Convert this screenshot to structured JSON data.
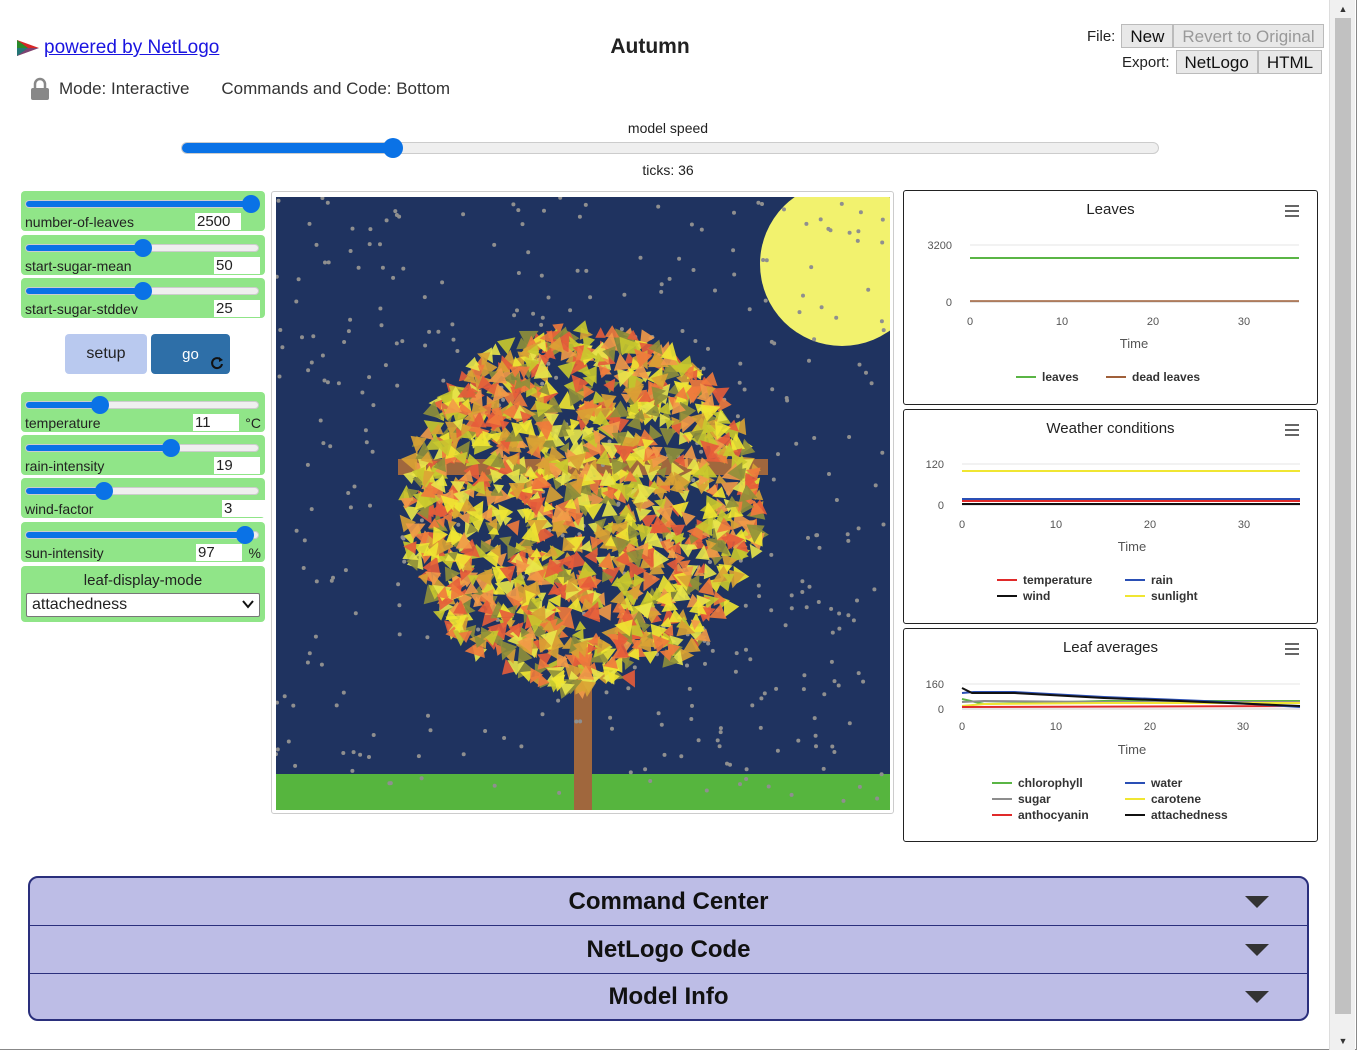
{
  "header": {
    "logo_link": "powered by NetLogo",
    "title": "Autumn",
    "file_label": "File:",
    "new_btn": "New",
    "revert_btn": "Revert to Original",
    "export_label": "Export:",
    "export_netlogo": "NetLogo",
    "export_html": "HTML",
    "mode": "Mode: Interactive",
    "commands_code": "Commands and Code: Bottom"
  },
  "speed": {
    "label": "model speed",
    "value_fraction": 0.21,
    "ticks": "ticks: 36"
  },
  "sliders": [
    {
      "name": "number-of-leaves",
      "value": "2500",
      "fraction": 1.0,
      "unit": ""
    },
    {
      "name": "start-sugar-mean",
      "value": "50",
      "fraction": 0.5,
      "unit": ""
    },
    {
      "name": "start-sugar-stddev",
      "value": "25",
      "fraction": 0.5,
      "unit": ""
    },
    {
      "name": "temperature",
      "value": "11",
      "fraction": 0.3,
      "unit": "°C"
    },
    {
      "name": "rain-intensity",
      "value": "19",
      "fraction": 0.63,
      "unit": ""
    },
    {
      "name": "wind-factor",
      "value": "3",
      "fraction": 0.32,
      "unit": ""
    },
    {
      "name": "sun-intensity",
      "value": "97",
      "fraction": 0.97,
      "unit": "%"
    }
  ],
  "buttons": {
    "setup": "setup",
    "go": "go"
  },
  "chooser": {
    "label": "leaf-display-mode",
    "value": "attachedness"
  },
  "plots": {
    "leaves": {
      "title": "Leaves",
      "xlabel": "Time",
      "y_ticks": [
        "3200",
        "0"
      ],
      "x_ticks": [
        "0",
        "10",
        "20",
        "30"
      ],
      "legend": [
        {
          "name": "leaves",
          "color": "#5ab545"
        },
        {
          "name": "dead leaves",
          "color": "#a0603a"
        }
      ]
    },
    "weather": {
      "title": "Weather conditions",
      "xlabel": "Time",
      "y_ticks": [
        "120",
        "0"
      ],
      "x_ticks": [
        "0",
        "10",
        "20",
        "30"
      ],
      "legend": [
        {
          "name": "temperature",
          "color": "#e02a2a"
        },
        {
          "name": "rain",
          "color": "#2a4fb5"
        },
        {
          "name": "wind",
          "color": "#111111"
        },
        {
          "name": "sunlight",
          "color": "#f0e632"
        }
      ]
    },
    "averages": {
      "title": "Leaf averages",
      "xlabel": "Time",
      "y_ticks": [
        "160",
        "0"
      ],
      "x_ticks": [
        "0",
        "10",
        "20",
        "30"
      ],
      "legend": [
        {
          "name": "chlorophyll",
          "color": "#5ab545"
        },
        {
          "name": "water",
          "color": "#2a4fb5"
        },
        {
          "name": "sugar",
          "color": "#8d8d8d"
        },
        {
          "name": "carotene",
          "color": "#f0e632"
        },
        {
          "name": "anthocyanin",
          "color": "#e02a2a"
        },
        {
          "name": "attachedness",
          "color": "#111111"
        }
      ]
    }
  },
  "tabs": [
    "Command Center",
    "NetLogo Code",
    "Model Info"
  ]
}
